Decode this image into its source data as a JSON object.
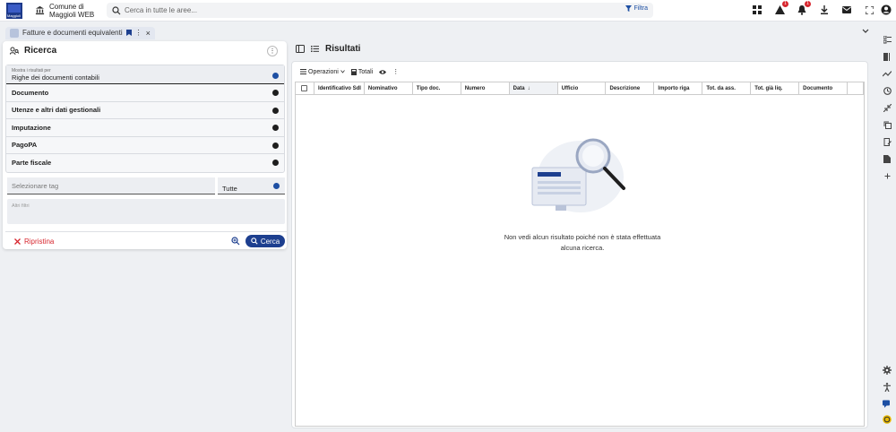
{
  "header": {
    "logo_text": "Maggioli",
    "org_line1": "Comune di",
    "org_line2": "Maggioli WEB",
    "search_placeholder": "Cerca in tutte le aree...",
    "filter_label": "Filtra",
    "warning_badge": "1",
    "notification_badge": "1"
  },
  "tab": {
    "label": "Fatture e documenti equivalenti"
  },
  "search_panel": {
    "title": "Ricerca",
    "show_results_label": "Mostra i risultati per",
    "show_results_value": "Righe dei documenti contabili",
    "sections": [
      "Documento",
      "Utenze e altri dati gestionali",
      "Imputazione",
      "PagoPA",
      "Parte fiscale"
    ],
    "tags_placeholder": "Selezionare tag",
    "tags_filter_value": "Tutte",
    "other_filters_placeholder": "Altri filtri",
    "reset_label": "Ripristina",
    "search_button": "Cerca"
  },
  "results": {
    "title": "Risultati",
    "operations_label": "Operazioni",
    "totals_label": "Totali",
    "columns": [
      "Identificativo SdI",
      "Nominativo",
      "Tipo doc.",
      "Numero",
      "Data",
      "Ufficio",
      "Descrizione",
      "Importo riga",
      "Tot. da ass.",
      "Tot. già liq.",
      "Documento"
    ],
    "sort_indicator": "↓",
    "empty_line1": "Non vedi alcun risultato poiché non è stata effettuata",
    "empty_line2": "alcuna ricerca."
  },
  "colors": {
    "primary": "#1d3f8f",
    "danger": "#d7262e",
    "badge": "#d7262e"
  }
}
